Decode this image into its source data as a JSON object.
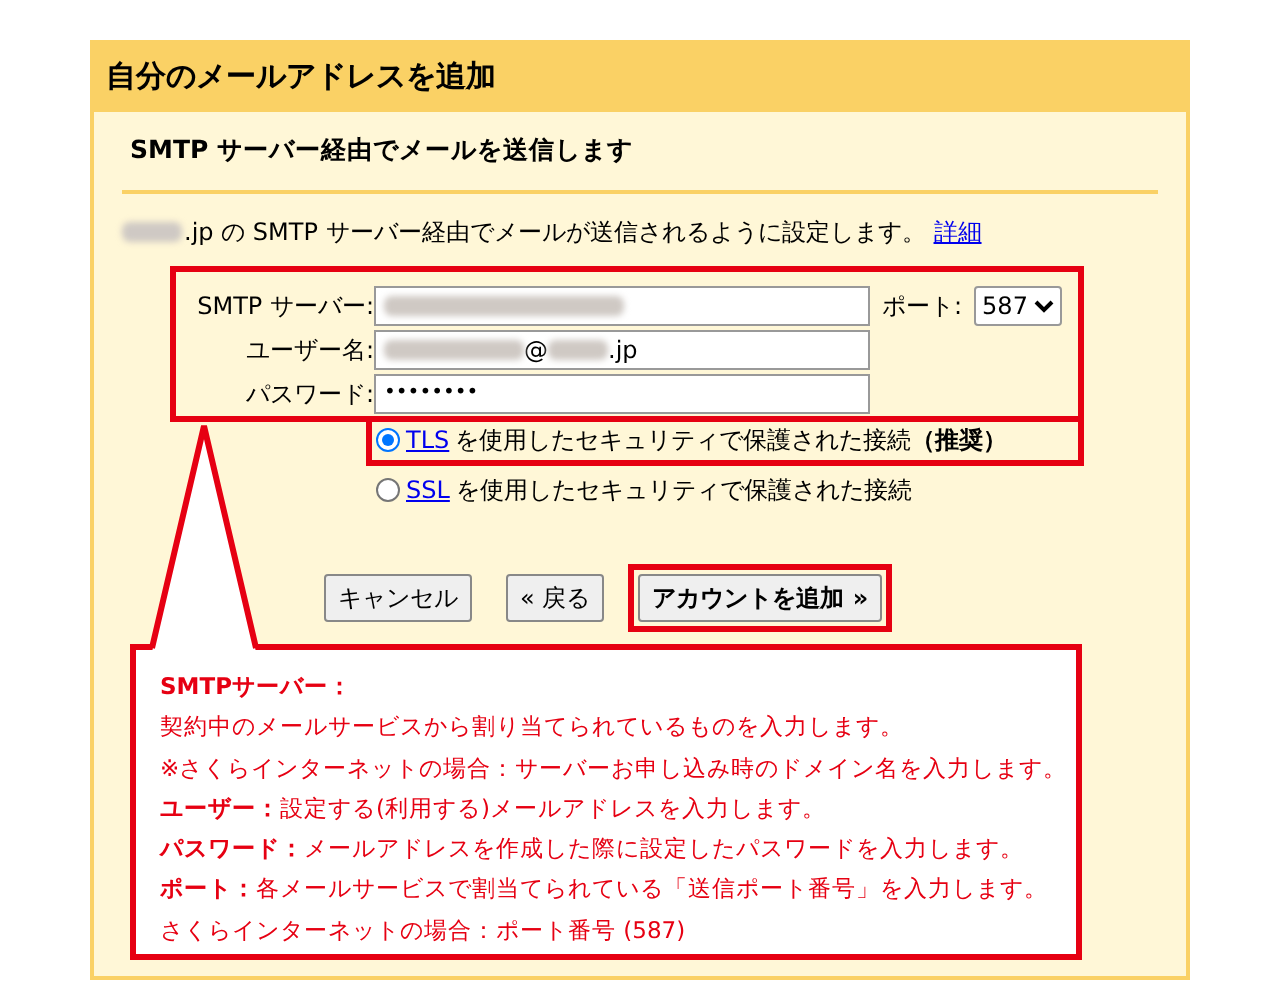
{
  "panel": {
    "title": "自分のメールアドレスを追加",
    "subtitle": "SMTP サーバー経由でメールを送信します",
    "description": {
      "domain_suffix": ".jp",
      "text": "の SMTP サーバー経由でメールが送信されるように設定します。",
      "link": "詳細"
    }
  },
  "form": {
    "server_label": "SMTP サーバー:",
    "port_label": "ポート:",
    "port_value": "587",
    "user_label": "ユーザー名:",
    "user_at": "@",
    "user_suffix": ".jp",
    "password_label": "パスワード:",
    "password_value": "••••••••"
  },
  "security": [
    {
      "link": "TLS",
      "text": "を使用したセキュリティで保護された接続",
      "note": "（推奨）",
      "selected": true,
      "highlighted": true
    },
    {
      "link": "SSL",
      "text": "を使用したセキュリティで保護された接続",
      "selected": false,
      "highlighted": false
    }
  ],
  "buttons": [
    {
      "label": "キャンセル",
      "primary": false,
      "highlighted": false
    },
    {
      "label": "« 戻る",
      "primary": false,
      "highlighted": false
    },
    {
      "label": "アカウントを追加 »",
      "primary": true,
      "highlighted": true
    }
  ],
  "callout": [
    {
      "kind": "heading",
      "text": "SMTPサーバー："
    },
    {
      "kind": "line",
      "text": "契約中のメールサービスから割り当てられているものを入力します。"
    },
    {
      "kind": "line",
      "text": "※さくらインターネットの場合：サーバーお申し込み時のドメイン名を入力します。"
    },
    {
      "kind": "line",
      "text": "**ユーザー：**設定する(利用する)メールアドレスを入力します。"
    },
    {
      "kind": "line",
      "text": "**パスワード：**メールアドレスを作成した際に設定したパスワードを入力します。"
    },
    {
      "kind": "line",
      "text": "**ポート：**各メールサービスで割当てられている「送信ポート番号」を入力します。"
    },
    {
      "kind": "line",
      "text": "さくらインターネットの場合：ポート番号 (587)"
    }
  ]
}
